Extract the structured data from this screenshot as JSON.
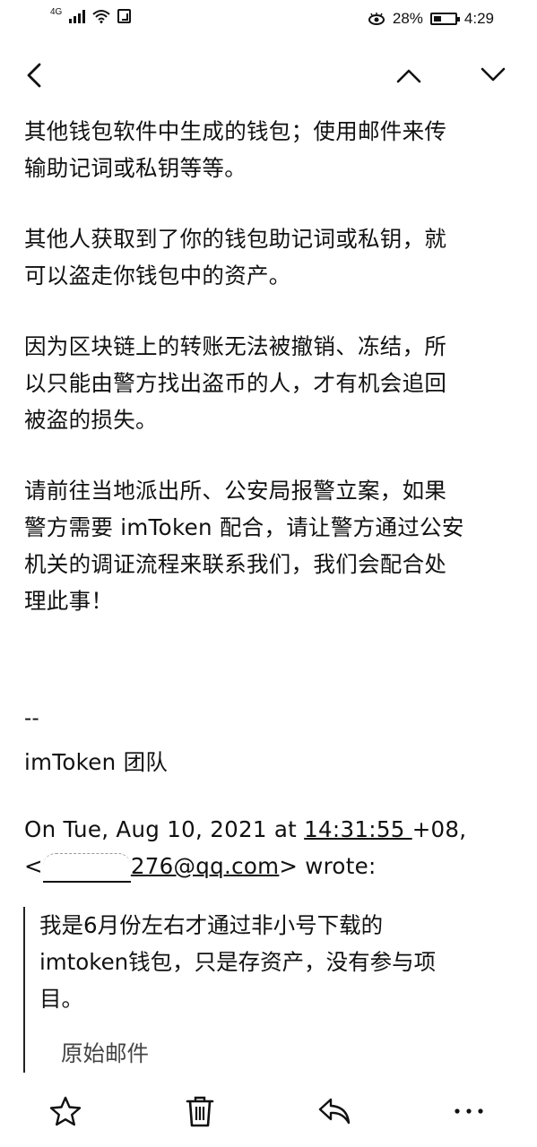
{
  "status_bar": {
    "network": "4G",
    "battery_percent": "28%",
    "time": "4:29",
    "icons": [
      "signal-icon",
      "wifi-icon",
      "nfc-icon",
      "eye-comfort-icon",
      "battery-icon"
    ]
  },
  "toolbar": {
    "icons": [
      "back-chevron-icon",
      "previous-mail-icon",
      "next-mail-icon"
    ]
  },
  "body": {
    "p1": [
      "其他钱包软件中生成的钱包；使用邮件来传",
      "输助记词或私钥等等。"
    ],
    "p2": [
      "其他人获取到了你的钱包助记词或私钥，就",
      "可以盗走你钱包中的资产。"
    ],
    "p3": [
      "因为区块链上的转账无法被撤销、冻结，所",
      "以只能由警方找出盗币的人，才有机会追回",
      "被盗的损失。"
    ],
    "p4": [
      "请前往当地派出所、公安局报警立案，如果",
      "警方需要 imToken 配合，请让警方通过公安",
      "机关的调证流程来联系我们，我们会配合处",
      "理此事！"
    ],
    "signature_dash": "--",
    "signature_team": "imToken 团队",
    "quote_header_prefix": "On Tue, Aug 10, 2021 at ",
    "quote_header_time": "14:31:55 ",
    "quote_header_tz": "+08,",
    "quote_email_open": "<",
    "quote_email_visible": "276@qq.com",
    "quote_email_suffix": "> wrote:"
  },
  "quote": {
    "lines": [
      "我是6月份左右才通过非小号下载的",
      "imtoken钱包，只是存资产，没有参与项",
      "目。"
    ],
    "cut_line": "原始邮件"
  },
  "bottom_bar": {
    "icons": [
      "star-icon",
      "delete-icon",
      "reply-icon",
      "more-icon"
    ]
  }
}
